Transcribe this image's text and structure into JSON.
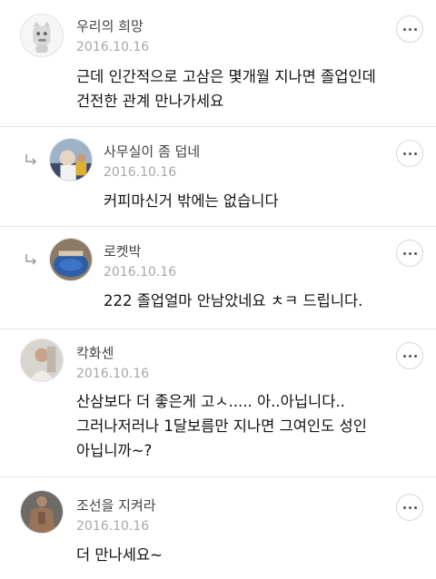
{
  "comments": [
    {
      "author": "우리의 희망",
      "date": "2016.10.16",
      "text": "근데 인간적으로 고삼은 몇개월 지나면 졸업인데\n건전한 관계 만나가세요",
      "is_reply": false,
      "avatar_icon": "cartoon-dog-avatar"
    },
    {
      "author": "사무실이 좀 덥네",
      "date": "2016.10.16",
      "text": "커피마신거 밖에는 없습니다",
      "is_reply": true,
      "avatar_icon": "photo-avatar"
    },
    {
      "author": "로켓박",
      "date": "2016.10.16",
      "text": "222 졸업얼마 안남았네요 ㅊㅋ 드립니다.",
      "is_reply": true,
      "avatar_icon": "photo-avatar"
    },
    {
      "author": "칵화센",
      "date": "2016.10.16",
      "text": "산삼보다 더 좋은게 고ㅅ.....  아..아닙니다..\n그러나저러나 1달보름만 지나면 그여인도 성인\n아닙니까~?",
      "is_reply": false,
      "avatar_icon": "photo-avatar"
    },
    {
      "author": "조선을 지켜라",
      "date": "2016.10.16",
      "text": "더 만나세요~",
      "is_reply": false,
      "avatar_icon": "photo-avatar"
    }
  ],
  "icons": {
    "more": "more-options-icon",
    "reply": "reply-arrow-icon"
  }
}
